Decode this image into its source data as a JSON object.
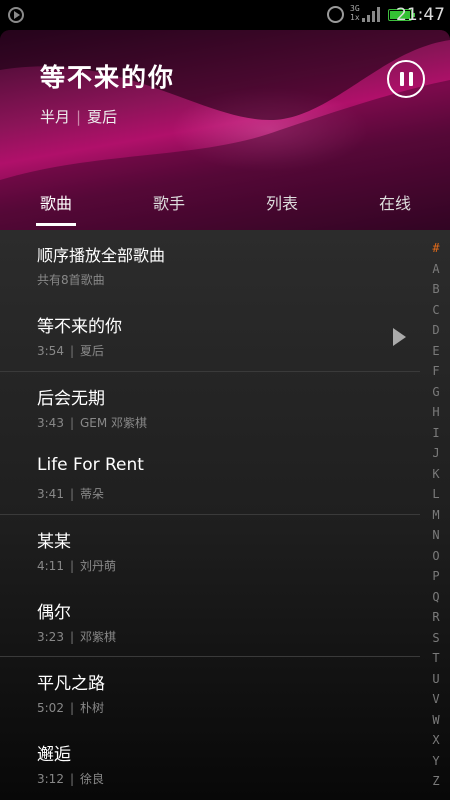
{
  "status_bar": {
    "network": "3G",
    "network_sub": "1x",
    "time": "21:47"
  },
  "now_playing": {
    "title": "等不来的你",
    "album": "半月",
    "artist": "夏后"
  },
  "tabs": [
    {
      "label": "歌曲",
      "active": true
    },
    {
      "label": "歌手",
      "active": false
    },
    {
      "label": "列表",
      "active": false
    },
    {
      "label": "在线",
      "active": false
    }
  ],
  "play_all": {
    "title": "顺序播放全部歌曲",
    "subtitle": "共有8首歌曲"
  },
  "songs": [
    {
      "title": "等不来的你",
      "duration": "3:54",
      "artist": "夏后"
    },
    {
      "title": "后会无期",
      "duration": "3:43",
      "artist": "GEM 邓紫棋"
    },
    {
      "title": "Life For Rent",
      "duration": "3:41",
      "artist": "蒂朵"
    },
    {
      "title": "某某",
      "duration": "4:11",
      "artist": "刘丹萌"
    },
    {
      "title": "偶尔",
      "duration": "3:23",
      "artist": "邓紫棋"
    },
    {
      "title": "平凡之路",
      "duration": "5:02",
      "artist": "朴树"
    },
    {
      "title": "邂逅",
      "duration": "3:12",
      "artist": "徐良"
    }
  ],
  "index_letters": [
    "#",
    "A",
    "B",
    "C",
    "D",
    "E",
    "F",
    "G",
    "H",
    "I",
    "J",
    "K",
    "L",
    "M",
    "N",
    "O",
    "P",
    "Q",
    "R",
    "S",
    "T",
    "U",
    "V",
    "W",
    "X",
    "Y",
    "Z"
  ]
}
